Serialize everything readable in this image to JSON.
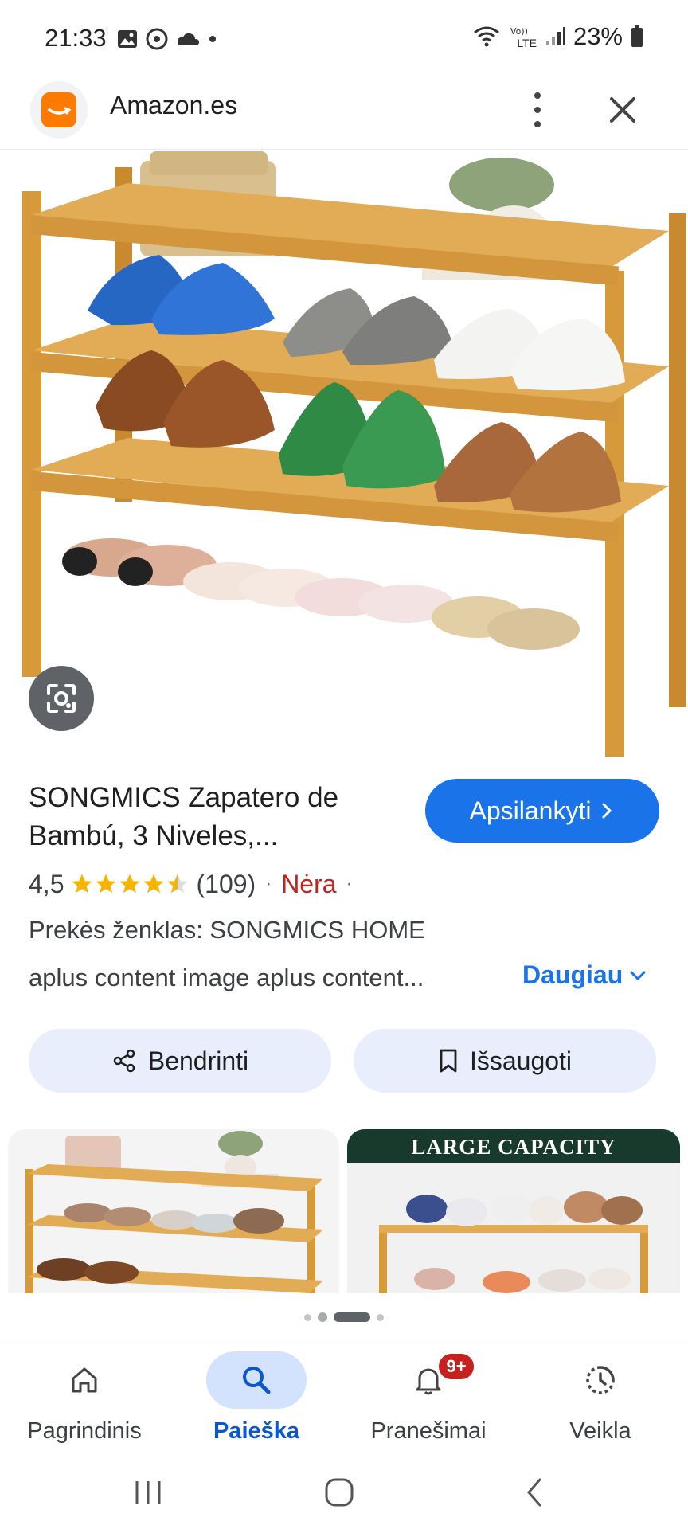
{
  "status_bar": {
    "time": "21:33",
    "battery": "23%",
    "network": "LTE",
    "icons_left": [
      "gallery-icon",
      "circle-icon",
      "cloud-icon",
      "dot-icon"
    ],
    "icons_right": [
      "wifi-icon",
      "volte-icon",
      "signal-icon",
      "battery-icon"
    ]
  },
  "header": {
    "site_title": "Amazon.es",
    "logo_icon": "amazon-logo-icon",
    "brand_color": "#ff7a00"
  },
  "product": {
    "title_line1": "SONGMICS Zapatero de",
    "title_line2": "Bambú, 3 Niveles,...",
    "visit_button": "Apsilankyti",
    "rating": "4,5",
    "rating_stars": 4.5,
    "review_count": "(109)",
    "stock": "Nėra",
    "brand": "Prekės ženklas: SONGMICS HOME",
    "description": "aplus content image aplus content...",
    "more_link": "Daugiau",
    "share_label": "Bendrinti",
    "save_label": "Išsaugoti",
    "accent_color": "#1a73e8",
    "stock_color": "#c5221f"
  },
  "thumbnails": {
    "banner": "LARGE CAPACITY"
  },
  "carousel": {
    "active_index": 2,
    "count": 4
  },
  "bottom_nav": {
    "items": [
      {
        "label": "Pagrindinis",
        "icon": "home-icon"
      },
      {
        "label": "Paieška",
        "icon": "search-icon"
      },
      {
        "label": "Pranešimai",
        "icon": "bell-icon",
        "badge": "9+"
      },
      {
        "label": "Veikla",
        "icon": "activity-icon"
      }
    ],
    "active_index": 1
  }
}
